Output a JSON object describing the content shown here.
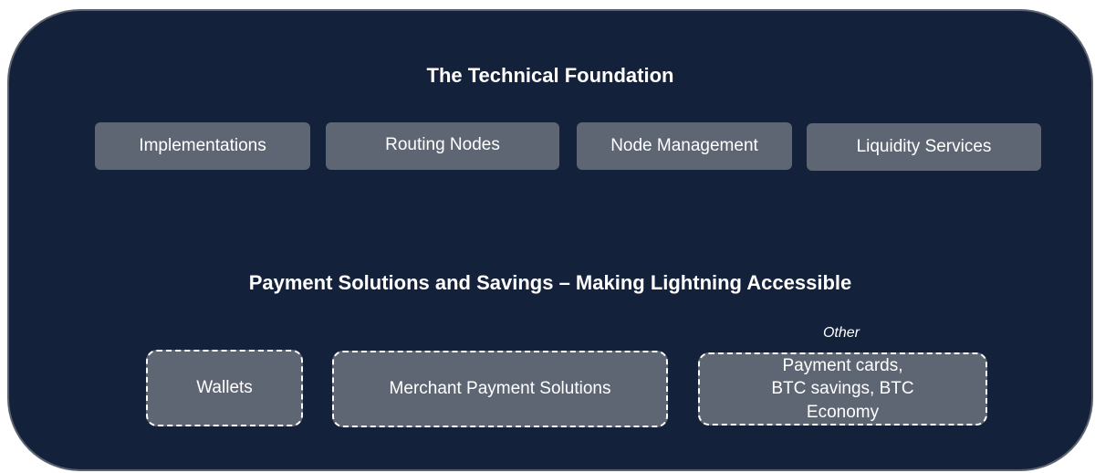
{
  "foundation": {
    "title": "The Technical Foundation",
    "items": [
      {
        "label": "Implementations"
      },
      {
        "label": "Routing Nodes"
      },
      {
        "label": "Node Management"
      },
      {
        "label": "Liquidity Services"
      }
    ]
  },
  "payments": {
    "title": "Payment Solutions and Savings – Making Lightning Accessible",
    "other_label": "Other",
    "items": [
      {
        "label": "Wallets"
      },
      {
        "label": "Merchant Payment Solutions"
      },
      {
        "label": "Payment cards, BTC savings, BTC Economy"
      }
    ]
  },
  "colors": {
    "panel_background": "#14213a",
    "box_fill": "#5f6673",
    "text": "#ffffff"
  }
}
